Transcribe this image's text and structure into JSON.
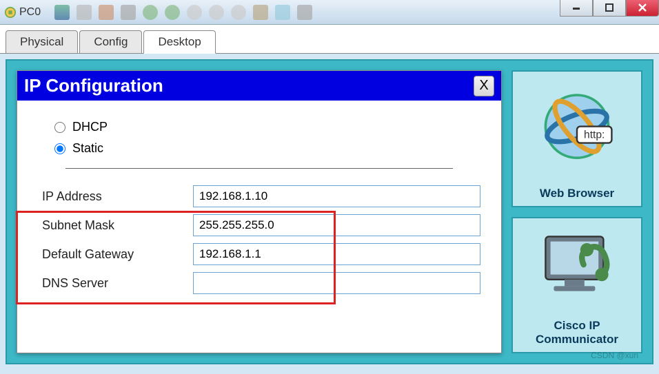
{
  "window": {
    "title": "PC0",
    "controls": {
      "min": "–",
      "max": "□",
      "close": "X"
    }
  },
  "tabs": [
    {
      "label": "Physical",
      "active": false
    },
    {
      "label": "Config",
      "active": false
    },
    {
      "label": "Desktop",
      "active": true
    }
  ],
  "ip_config": {
    "title": "IP Configuration",
    "close": "X",
    "mode": {
      "dhcp_label": "DHCP",
      "static_label": "Static",
      "selected": "static"
    },
    "fields": {
      "ip_label": "IP Address",
      "ip_value": "192.168.1.10",
      "mask_label": "Subnet Mask",
      "mask_value": "255.255.255.0",
      "gw_label": "Default Gateway",
      "gw_value": "192.168.1.1",
      "dns_label": "DNS Server",
      "dns_value": ""
    }
  },
  "side_apps": {
    "web_browser": {
      "label": "Web Browser",
      "badge": "http:"
    },
    "cisco_ip_comm": {
      "label": "Cisco IP Communicator"
    }
  },
  "watermark": "CSDN @xun"
}
